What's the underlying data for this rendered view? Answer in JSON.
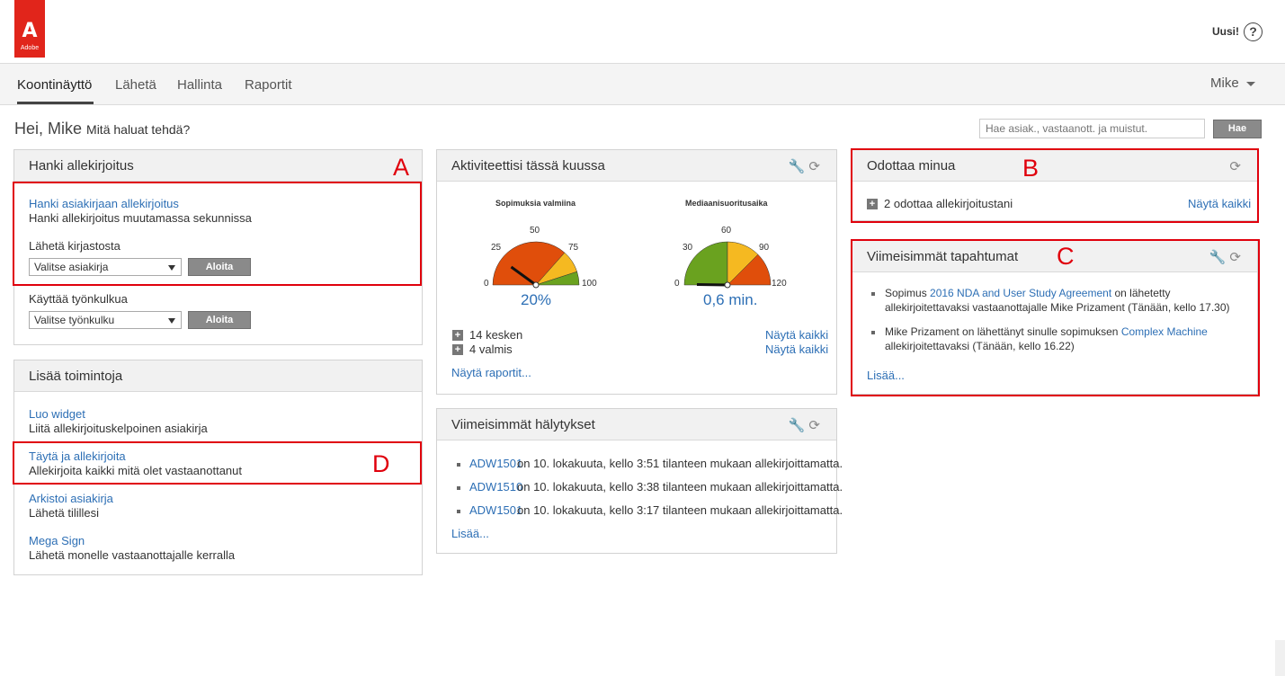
{
  "header": {
    "logo_mark": "A",
    "logo_word": "Adobe",
    "new_label": "Uusi!",
    "help_glyph": "?"
  },
  "nav": {
    "tabs": [
      "Koontinäyttö",
      "Lähetä",
      "Hallinta",
      "Raportit"
    ],
    "user": "Mike"
  },
  "greeting": {
    "hello": "Hei, Mike",
    "question": "Mitä haluat tehdä?"
  },
  "search": {
    "placeholder": "Hae asiak., vastaanott. ja muistut.",
    "button": "Hae"
  },
  "get_signature": {
    "title": "Hanki allekirjoitus",
    "link": "Hanki asiakirjaan allekirjoitus",
    "desc": "Hanki allekirjoitus muutamassa sekunnissa",
    "library_label": "Lähetä kirjastosta",
    "library_select": "Valitse asiakirja",
    "start": "Aloita",
    "workflow_label": "Käyttää työnkulkua",
    "workflow_select": "Valitse työnkulku"
  },
  "more_actions": {
    "title": "Lisää toimintoja",
    "items": [
      {
        "link": "Luo widget",
        "desc": "Liitä allekirjoituskelpoinen asiakirja"
      },
      {
        "link": "Täytä ja allekirjoita",
        "desc": "Allekirjoita kaikki mitä olet vastaanottanut"
      },
      {
        "link": "Arkistoi asiakirja",
        "desc": "Lähetä tilillesi"
      },
      {
        "link": "Mega Sign",
        "desc": "Lähetä monelle vastaanottajalle kerralla"
      }
    ]
  },
  "activity": {
    "title": "Aktiviteettisi tässä kuussa",
    "gauge1": {
      "title": "Sopimuksia valmiina",
      "ticks": [
        "0",
        "25",
        "50",
        "75",
        "100"
      ],
      "value": "20%",
      "percent": 20
    },
    "gauge2": {
      "title": "Mediaanisuoritusaika",
      "ticks": [
        "0",
        "30",
        "60",
        "90",
        "120"
      ],
      "value": "0,6 min.",
      "percent": 0.5
    },
    "in_progress": "14 kesken",
    "done": "4 valmis",
    "show_all": "Näytä kaikki",
    "show_reports": "Näytä raportit..."
  },
  "alerts": {
    "title": "Viimeisimmät hälytykset",
    "items": [
      {
        "id": "ADW1501",
        "text": "on 10. lokakuuta, kello 3:51 tilanteen mukaan allekirjoittamatta."
      },
      {
        "id": "ADW1510",
        "text": "on 10. lokakuuta, kello 3:38 tilanteen mukaan allekirjoittamatta."
      },
      {
        "id": "ADW1501",
        "text": "on 10. lokakuuta, kello 3:17 tilanteen mukaan allekirjoittamatta."
      }
    ],
    "more": "Lisää..."
  },
  "waiting": {
    "title": "Odottaa minua",
    "item": "2 odottaa allekirjoitustani",
    "show_all": "Näytä kaikki"
  },
  "recent": {
    "title": "Viimeisimmät tapahtumat",
    "e1_pre": "Sopimus",
    "e1_link": "2016 NDA and User Study Agreement",
    "e1_post": "on lähetetty",
    "e1_line2": "allekirjoitettavaksi vastaanottajalle Mike Prizament (Tänään, kello 17.30)",
    "e2_pre": "Mike Prizament on lähettänyt sinulle sopimuksen",
    "e2_link": "Complex Machine",
    "e2_line2": "allekirjoitettavaksi (Tänään, kello 16.22)",
    "more": "Lisää..."
  },
  "annotations": {
    "a": "A",
    "b": "B",
    "c": "C",
    "d": "D"
  },
  "icons": {
    "wrench": "wrench-icon",
    "refresh": "refresh-icon",
    "plus": "plus-icon"
  },
  "colors": {
    "accent_link": "#2d6fb5",
    "gauge_red": "#e04e0b",
    "gauge_yellow": "#f5b921",
    "gauge_green": "#6aa21f",
    "annotation_red": "#e0000c",
    "logo_red": "#e1251b"
  }
}
